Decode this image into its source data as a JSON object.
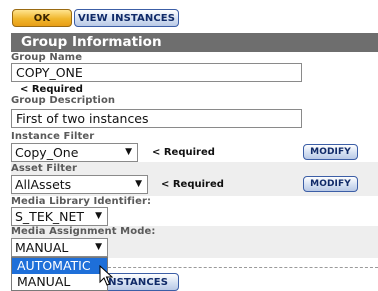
{
  "toolbar": {
    "ok_label": "OK",
    "view_instances_label": "VIEW INSTANCES"
  },
  "section": {
    "title": "Group Information"
  },
  "group_name": {
    "label": "Group Name",
    "value": "COPY_ONE",
    "required": "< Required"
  },
  "group_description": {
    "label": "Group Description",
    "value": "First of two instances"
  },
  "instance_filter": {
    "label": "Instance Filter",
    "value": "Copy_One",
    "required": "< Required",
    "modify_label": "MODIFY"
  },
  "asset_filter": {
    "label": "Asset Filter",
    "value": "AllAssets",
    "required": "< Required",
    "modify_label": "MODIFY"
  },
  "media_library": {
    "label": "Media Library Identifier:",
    "value": "S_TEK_NET"
  },
  "media_assignment": {
    "label": "Media Assignment Mode:",
    "value": "MANUAL",
    "options": [
      "AUTOMATIC",
      "MANUAL"
    ],
    "highlighted": "AUTOMATIC"
  },
  "bottom_button_partial": "INSTANCES",
  "icons": {
    "dropdown_arrow": "▼",
    "cursor": "mouse-pointer-icon"
  }
}
